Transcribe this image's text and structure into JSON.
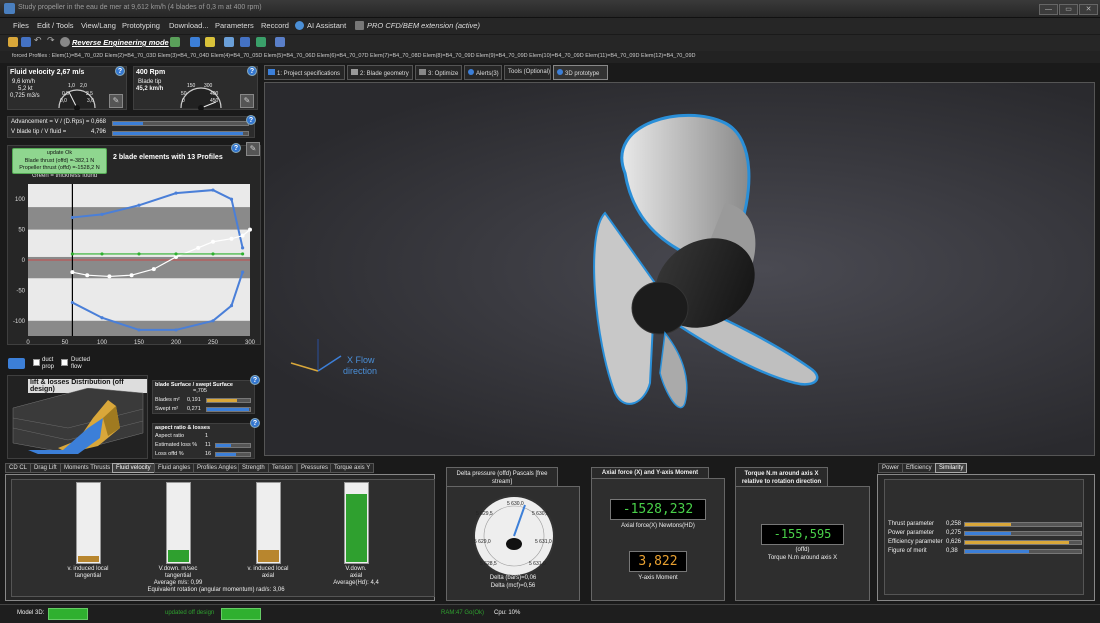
{
  "window": {
    "title": "Study propeller in the eau de mer at 9,612 km/h (4 blades of 0,3 m at 400 rpm)",
    "min": "—",
    "max": "▭",
    "close": "✕"
  },
  "menu": [
    "Files",
    "Edit / Tools",
    "View/Lang",
    "Prototyping",
    "Download...",
    "Parameters",
    "Reccord",
    "AI Assistant",
    "PRO CFD/BEM extension (active)"
  ],
  "toolbar": {
    "mode": "Reverse Engineering mode"
  },
  "profiles_line": "forced Profiles : Elem(1)=B4_70_02D Elem(2)=B4_70_03D Elem(3)=B4_70_04D Elem(4)=B4_70_05D Elem(5)=B4_70_06D Elem(6)=B4_70_07D Elem(7)=B4_70_08D Elem(8)=B4_70_09D Elem(9)=B4_70_09D Elem(10)=B4_70_09D Elem(11)=B4_70_09D Elem(12)=B4_70_09D",
  "fluid": {
    "title": "Fluid velocity 2,67 m/s",
    "kmh": "9,6 km/h",
    "kt": "5,2 kt",
    "m3s": "0,725 m3/s",
    "g1": "1,0",
    "g2": "2,0",
    "g3": "0,5",
    "g4": "2,5",
    "g5": "0,0",
    "g6": "3,0"
  },
  "rpm": {
    "title": "400 Rpm",
    "sub1": "Blade tip",
    "sub2": "45,2 km/h",
    "g1": "150",
    "g2": "300",
    "g3": "50",
    "g4": "400",
    "g5": "0",
    "g6": "450"
  },
  "advancement": {
    "label1": "Advancement = V / (D.Rps) =",
    "val1": "0,668",
    "frac1": 0.22,
    "label2": "V blade tip / V fluid =",
    "val2": "4,796",
    "frac2": 0.96
  },
  "tooltip": {
    "l1": "update Ok",
    "l2": "Blade thrust (offd) =-382,1 N",
    "l3": "Propeller thrust (offd) =-1528,2 N"
  },
  "profile_chart": {
    "title": "2 blade elements with 13 Profiles",
    "legend": "Green = thickness found"
  },
  "chart_data": {
    "type": "line",
    "x_ticks": [
      "0",
      "50",
      "100",
      "150",
      "200",
      "250",
      "300"
    ],
    "y_ticks": [
      "100",
      "50",
      "0",
      "-50",
      "-100"
    ],
    "xlim": [
      0,
      300
    ],
    "ylim": [
      -125,
      125
    ],
    "series": [
      {
        "x": [
          60,
          100,
          150,
          200,
          250,
          275,
          290
        ],
        "y": [
          70,
          75,
          90,
          110,
          115,
          100,
          20
        ]
      },
      {
        "x": [
          60,
          100,
          150,
          200,
          250,
          275,
          290
        ],
        "y": [
          -70,
          -95,
          -115,
          -115,
          -100,
          -75,
          -20
        ]
      },
      {
        "x": [
          60,
          80,
          110,
          140,
          170,
          200,
          230,
          250,
          275,
          290,
          300
        ],
        "y": [
          -20,
          -25,
          -27,
          -25,
          -15,
          5,
          20,
          30,
          35,
          40,
          50
        ]
      },
      {
        "x": [
          60,
          100,
          150,
          200,
          250,
          290
        ],
        "y": [
          10,
          10,
          10,
          10,
          10,
          10
        ]
      }
    ]
  },
  "options": {
    "duct": "duct",
    "prop": "prop",
    "ducted": "Ducted",
    "flow": "flow"
  },
  "lift": {
    "title": "lift & losses Distribution (off design)"
  },
  "surface": {
    "title": "blade Surface / swept Surface",
    "ratio": "=,705",
    "blades": "Blades m²",
    "blades_val": "0,191",
    "blades_frac": 0.7,
    "swept": "Swept m²",
    "swept_val": "0,271",
    "swept_frac": 0.97
  },
  "aspect": {
    "title": "aspect ratio & losses",
    "ratio": "Aspect ratio",
    "ratio_val": "1",
    "loss": "Estimated loss %",
    "loss_val": "11",
    "loss_frac": 0.45,
    "lossoff": "Loss offd %",
    "lossoff_val": "16",
    "lossoff_frac": 0.6
  },
  "tabs": [
    {
      "label": "1: Project specifications",
      "icon": "doc-icon"
    },
    {
      "label": "2: Blade geometry",
      "icon": "blade-icon"
    },
    {
      "label": "3: Optimize",
      "icon": "optimize-icon"
    },
    {
      "label": "Alerts(3)",
      "icon": "alert-icon"
    },
    {
      "label": "Tools (Optional)",
      "icon": ""
    },
    {
      "label": "3D prototype",
      "icon": "cube-icon"
    }
  ],
  "view3d": {
    "axis": "X Flow",
    "axis2": "direction"
  },
  "bottom_tabs": [
    "CD CL",
    "Drag Lift",
    "Moments Thrusts",
    "Fluid velocity",
    "Fluid angles",
    "Profiles Angles",
    "Strength",
    "Tension",
    "Pressures",
    "Torque axis Y"
  ],
  "velocity": {
    "g1a": "v. induced local",
    "g1b": "tangential",
    "g2a": "V.down. m/sec",
    "g2b": "tangential",
    "g2c": "Average m/s: 0,99",
    "g3a": "v. induced local",
    "g3b": "axial",
    "g4a": "V.down.",
    "g4b": "axial",
    "g4c": "Average(Hd): 4,4",
    "footer": "Equivalent rotation (angular momentum) rad/s: 3,06"
  },
  "delta": {
    "title": "Delta pressure (offd) Pascals [free stream]",
    "t1": "5 630,0",
    "t2": "5 629,5",
    "t3": "5 630,5",
    "t4": "5 629,0",
    "t5": "5 631,0",
    "t6": "5 628,5",
    "t7": "5 631,0",
    "bars": "Delta (bars)=0,06",
    "mcf": "Delta (mcf)=0,56"
  },
  "axial": {
    "title": "Axial force (X) and Y-axis Moment",
    "val": "-1528,232",
    "label": "Axial force(X) Newtons(HD)",
    "mval": "3,822",
    "mlabel": "Y-axis Moment"
  },
  "torque": {
    "title": "Torque N.m around axis X relative to rotation direction",
    "val": "-155,595",
    "l1": "(offd)",
    "l2": "Torque N.m around axis X"
  },
  "right_tabs": [
    "Power",
    "Efficiency",
    "Similarity"
  ],
  "similarity": [
    {
      "label": "Thrust parameter",
      "val": "0,258",
      "frac": 0.4
    },
    {
      "label": "Power parameter",
      "val": "0,275",
      "frac": 0.4
    },
    {
      "label": "Efficiency parameter",
      "val": "0,626",
      "frac": 0.9
    },
    {
      "label": "Figure of merit",
      "val": "0,38",
      "frac": 0.55
    }
  ],
  "status": {
    "model": "Model 3D:",
    "updated": "updated off design",
    "ram": "RAM:47 Go(Ok)",
    "cpu": "Cpu: 10%"
  },
  "colors": {
    "accent": "#3c7fd8",
    "gold": "#d9a73a",
    "green": "#2fb02f",
    "seg": "#49d049"
  }
}
